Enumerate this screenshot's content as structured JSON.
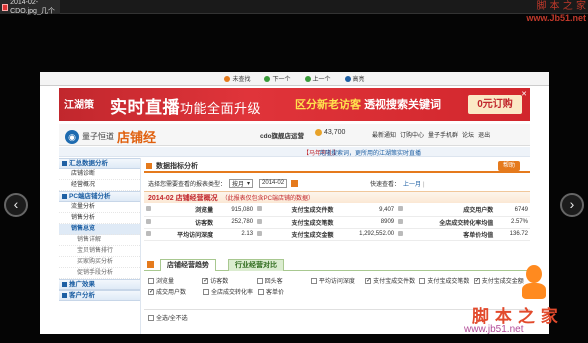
{
  "window": {
    "tab_title": "2014-02-CDO.jpg_几个"
  },
  "watermark_top": {
    "line1": "脚 本 之 家",
    "line2": "www.Jb51.net"
  },
  "viewer_toolbar": {
    "items": [
      {
        "label": "未查找",
        "color": "#e57a1d"
      },
      {
        "label": "下一个",
        "color": "#3a9a3a"
      },
      {
        "label": "上一个",
        "color": "#3a9a3a"
      },
      {
        "label": "高亮",
        "color": "#1d5fa3"
      }
    ]
  },
  "banner": {
    "logo": "江湖策",
    "headline": "实时直播",
    "headline_sub": "功能全面升级",
    "slogan_a": "区分新老访客",
    "slogan_b": "透视搜索关键词",
    "cta": "0元订购",
    "close": "✕"
  },
  "header": {
    "brand_name": "量子恒道",
    "brand_product": "店铺经",
    "shop_name": "cdo旗舰店运营",
    "score": "43,700",
    "links": [
      "最新通知",
      "订购中心",
      "量子手机群",
      "论坛",
      "退出"
    ]
  },
  "notice": {
    "tag": "【马年有礼】",
    "text": "克隆搜索词，更所用的江湖策实时直播"
  },
  "sidebar": {
    "groups": [
      {
        "label": "汇总数据分析",
        "items": [
          {
            "label": "店铺诊断",
            "level": "item"
          },
          {
            "label": "经营概况",
            "level": "item"
          }
        ]
      },
      {
        "label": "PC端店铺分析",
        "items": [
          {
            "label": "流量分析",
            "level": "item"
          },
          {
            "label": "销售分析",
            "level": "item"
          },
          {
            "label": "销售总览",
            "level": "active"
          },
          {
            "label": "销售详解",
            "level": "sub"
          },
          {
            "label": "宝贝销售排行",
            "level": "sub"
          },
          {
            "label": "买家购买分析",
            "level": "sub"
          },
          {
            "label": "促销手段分析",
            "level": "sub"
          }
        ]
      },
      {
        "label": "推广效果",
        "items": []
      },
      {
        "label": "客户分析",
        "items": []
      }
    ]
  },
  "main": {
    "title": "数据指标分析",
    "help": "帮助",
    "filter_label": "选择您需要查看的报表类型：",
    "report_type": "按月",
    "date_value": "2014-02",
    "quick_label": "快速查看：",
    "quick_link": "上一月",
    "quick_sep": "|",
    "overview_title": "2014-02 店铺经营概况",
    "overview_note": "（此报表仅包含PC端店铺的数据）",
    "overview": [
      [
        "浏览量",
        "915,080",
        "支付宝成交件数",
        "9,407",
        "成交用户数",
        "6749"
      ],
      [
        "访客数",
        "252,780",
        "支付宝成交笔数",
        "8909",
        "全店成交转化率均值",
        "2.57%"
      ],
      [
        "平均访问深度",
        "2.13",
        "支付宝成交金额",
        "1,292,552.00",
        "客单价均值",
        "136.72"
      ]
    ],
    "tab_active": "店铺经营趋势",
    "tab_other": "行业经营对比",
    "metrics": [
      {
        "label": "浏览量",
        "checked": false
      },
      {
        "label": "访客数",
        "checked": true
      },
      {
        "label": "回头客",
        "checked": false
      },
      {
        "label": "平均访问深度",
        "checked": false
      },
      {
        "label": "支付宝成交件数",
        "checked": true
      },
      {
        "label": "支付宝成交笔数",
        "checked": false
      },
      {
        "label": "支付宝成交金额",
        "checked": true
      },
      {
        "label": "成交用户数",
        "checked": true
      },
      {
        "label": "全店成交转化率",
        "checked": false
      },
      {
        "label": "客单价",
        "checked": false
      }
    ],
    "select_all": "全选/全不选"
  },
  "nav": {
    "prev": "‹",
    "next": "›"
  },
  "watermark_bottom": {
    "line1": "脚 本 之 家",
    "line2": "www.jb51.net"
  }
}
